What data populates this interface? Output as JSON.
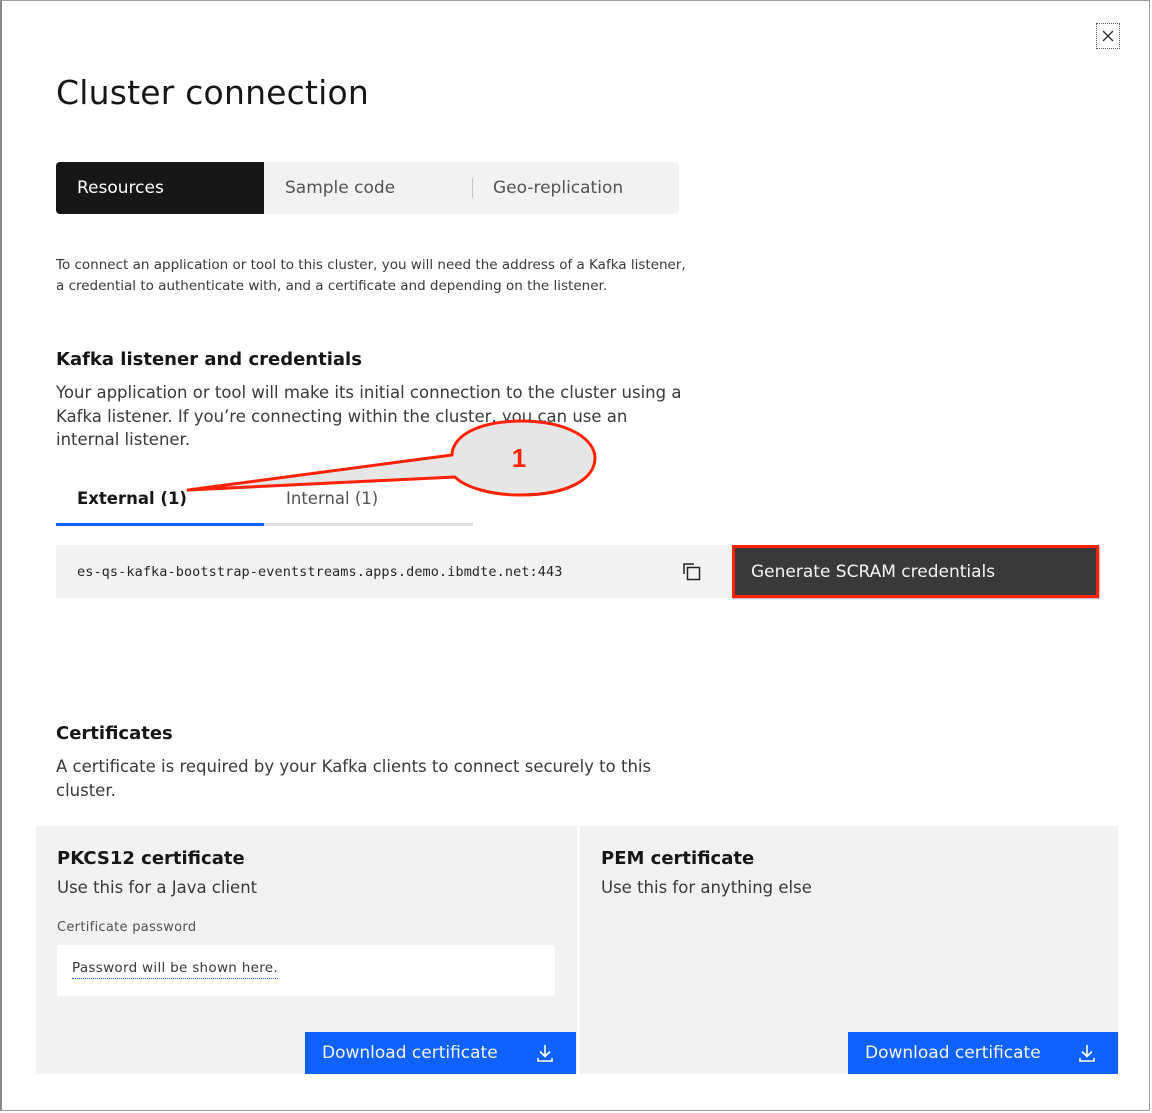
{
  "modal": {
    "title": "Cluster connection",
    "close_icon": "close-icon"
  },
  "switcher": {
    "items": [
      {
        "label": "Resources",
        "selected": true
      },
      {
        "label": "Sample code",
        "selected": false
      },
      {
        "label": "Geo-replication",
        "selected": false
      }
    ]
  },
  "intro": "To connect an application or tool to this cluster, you will need the address of a Kafka listener, a credential to authenticate with, and a certificate and depending on the listener.",
  "listener": {
    "heading": "Kafka listener and credentials",
    "description": "Your application or tool will make its initial connection to the cluster using a Kafka listener. If you’re connecting within the cluster, you can use an internal listener.",
    "tabs": [
      {
        "label": "External (1)",
        "selected": true
      },
      {
        "label": "Internal (1)",
        "selected": false
      }
    ],
    "address": "es-qs-kafka-bootstrap-eventstreams.apps.demo.ibmdte.net:443",
    "copy_icon": "copy-icon",
    "generate_button": "Generate SCRAM credentials"
  },
  "callout": {
    "number": "1",
    "border_color": "#ff2200",
    "fill_color": "#e6e6e6"
  },
  "certificates": {
    "heading": "Certificates",
    "description": "A certificate is required by your Kafka clients to connect securely to this cluster.",
    "pkcs12": {
      "title": "PKCS12 certificate",
      "subtitle": "Use this for a Java client",
      "password_label": "Certificate password",
      "password_value": "Password will be shown here.",
      "download_button": "Download certificate"
    },
    "pem": {
      "title": "PEM certificate",
      "subtitle": "Use this for anything else",
      "download_button": "Download certificate"
    }
  },
  "colors": {
    "primary": "#0f62fe",
    "dark": "#161616",
    "tile_bg": "#f2f2f2",
    "highlight": "#ff2200"
  }
}
